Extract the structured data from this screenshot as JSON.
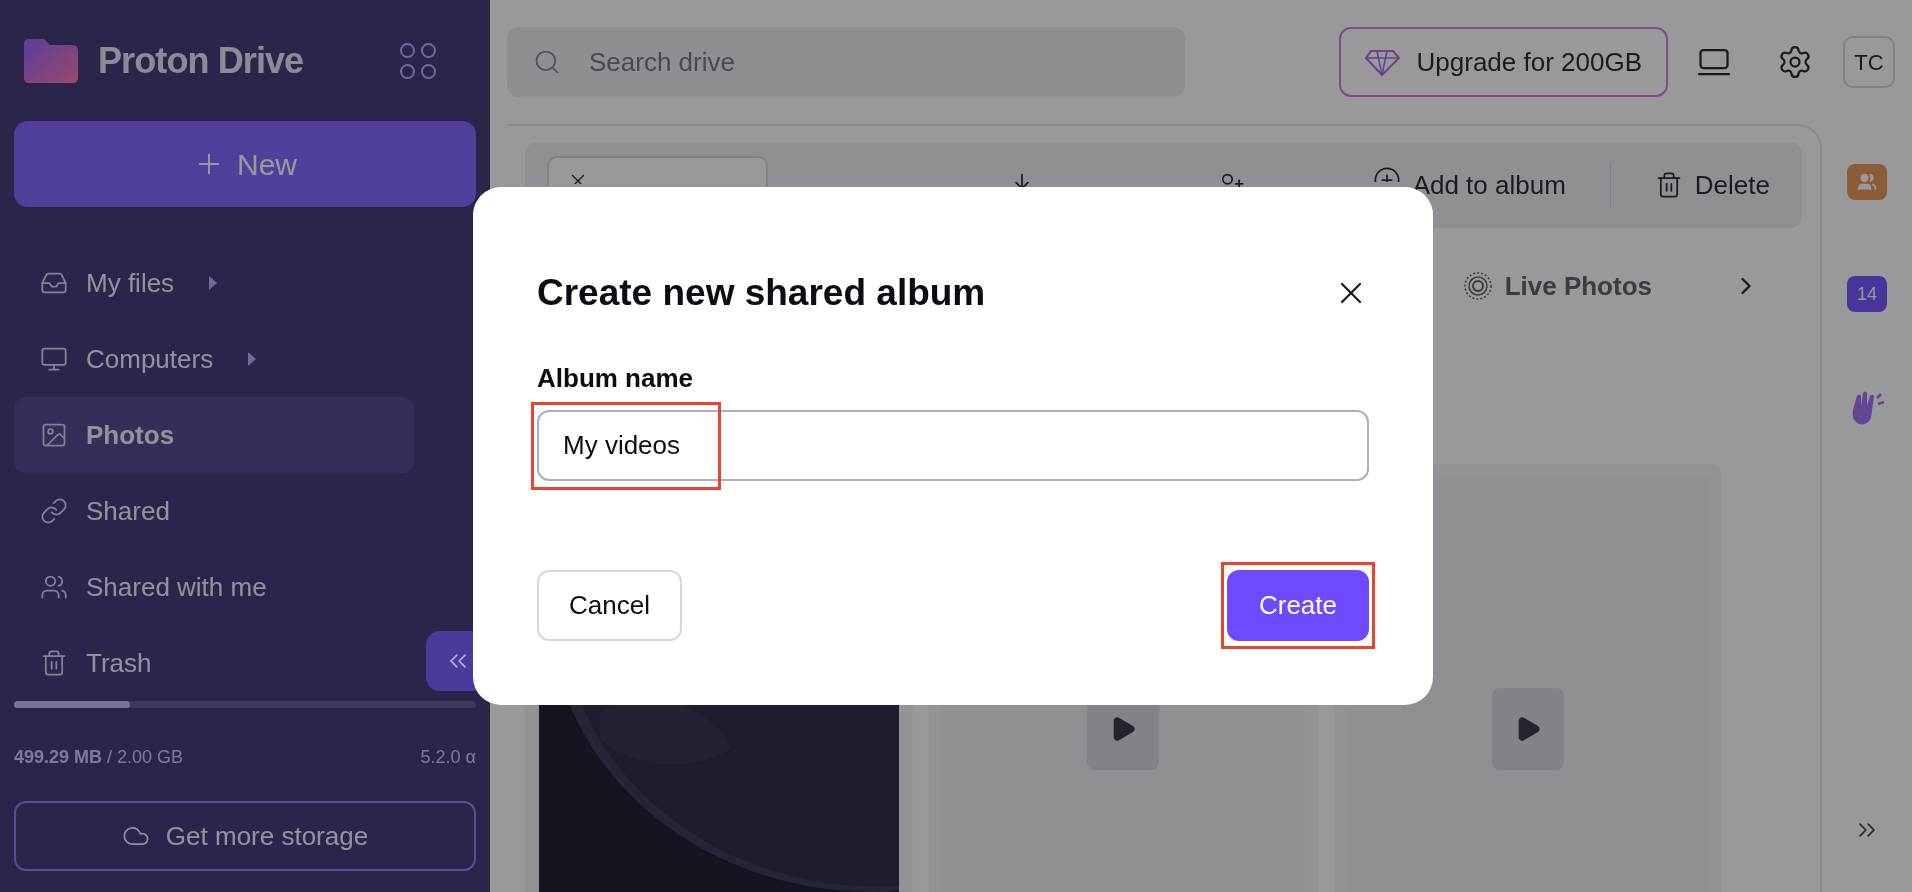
{
  "sidebar": {
    "brand": "Proton Drive",
    "new_button": "New",
    "items": [
      {
        "label": "My files",
        "has_submenu": true,
        "selected": false
      },
      {
        "label": "Computers",
        "has_submenu": true,
        "selected": false
      },
      {
        "label": "Photos",
        "has_submenu": false,
        "selected": true
      },
      {
        "label": "Shared",
        "has_submenu": false,
        "selected": false
      },
      {
        "label": "Shared with me",
        "has_submenu": false,
        "selected": false
      },
      {
        "label": "Trash",
        "has_submenu": false,
        "selected": false
      }
    ],
    "storage": {
      "level": 0.25,
      "used": "499.29 MB",
      "total": "/ 2.00 GB",
      "version": "5.2.0 α"
    },
    "get_storage_button": "Get more storage"
  },
  "topbar": {
    "search": {
      "placeholder": "Search drive"
    },
    "upgrade_button": "Upgrade for 200GB",
    "avatar": "TC"
  },
  "toolbar": {
    "actions": [
      "Add to album",
      "Delete"
    ]
  },
  "filters": [
    {
      "label": "Live Photos"
    }
  ],
  "photos": [
    {
      "kind": "picture"
    },
    {
      "kind": "video"
    },
    {
      "kind": "video"
    }
  ],
  "right_rail": {
    "calendar_day": "14"
  },
  "dialog": {
    "title": "Create new shared album",
    "field_label": "Album name",
    "field_value": "My videos",
    "field_highlighted": true,
    "buttons": [
      {
        "label": "Cancel",
        "kind": "secondary",
        "highlighted": false
      },
      {
        "label": "Create",
        "kind": "primary",
        "highlighted": true
      }
    ]
  }
}
